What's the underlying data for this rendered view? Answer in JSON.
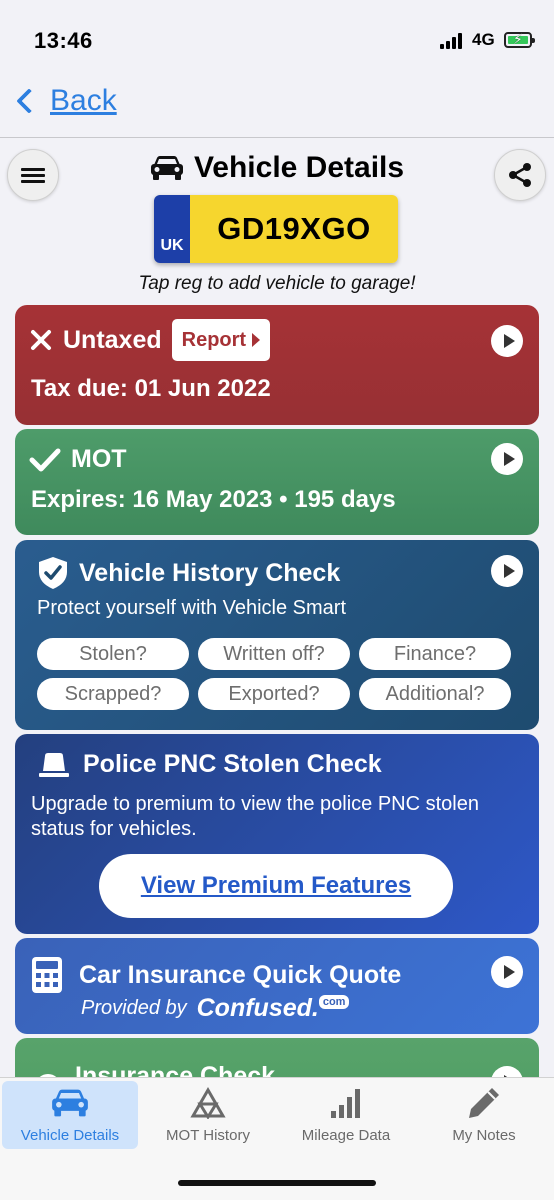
{
  "status_bar": {
    "time": "13:46",
    "network": "4G",
    "battery_color": "#34c759"
  },
  "nav": {
    "back_label": "Back",
    "accent": "#2d7fe0"
  },
  "header": {
    "title": "Vehicle Details",
    "plate": {
      "country": "UK",
      "registration": "GD19XGO"
    },
    "hint": "Tap reg to add vehicle to garage!"
  },
  "cards": {
    "tax": {
      "status": "Untaxed",
      "report_label": "Report",
      "detail": "Tax due: 01 Jun 2022",
      "color": "#a63236"
    },
    "mot": {
      "status": "MOT",
      "detail": "Expires: 16 May 2023 • 195 days",
      "color": "#4e9c6a"
    },
    "history": {
      "title": "Vehicle History Check",
      "subtitle": "Protect yourself with Vehicle Smart",
      "chips": [
        "Stolen?",
        "Written off?",
        "Finance?",
        "Scrapped?",
        "Exported?",
        "Additional?"
      ]
    },
    "pnc": {
      "title": "Police PNC Stolen Check",
      "description": "Upgrade to premium to view the police PNC stolen status for vehicles.",
      "button_label": "View Premium Features"
    },
    "quote": {
      "title": "Car Insurance Quick Quote",
      "provided_by": "Provided by",
      "provider": "Confused.",
      "provider_suffix": "com"
    },
    "insurance": {
      "title": "Insurance Check"
    }
  },
  "tabs": [
    {
      "label": "Vehicle Details",
      "icon": "car-icon",
      "active": true
    },
    {
      "label": "MOT History",
      "icon": "mot-icon",
      "active": false
    },
    {
      "label": "Mileage Data",
      "icon": "bar-chart-icon",
      "active": false
    },
    {
      "label": "My Notes",
      "icon": "pencil-icon",
      "active": false
    }
  ]
}
